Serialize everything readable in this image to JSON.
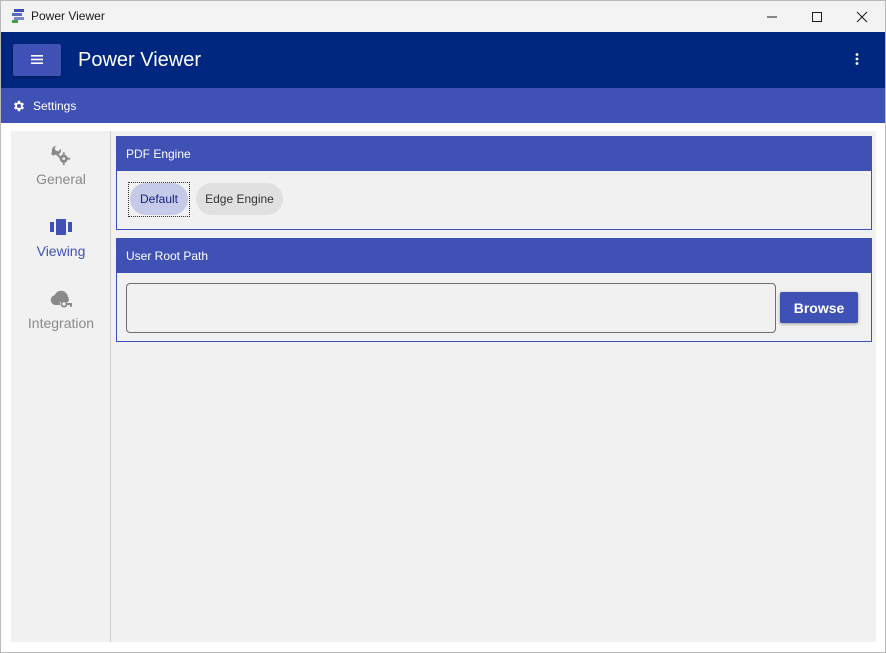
{
  "window": {
    "title": "Power Viewer"
  },
  "appbar": {
    "title": "Power Viewer",
    "menu_icon": "hamburger-icon",
    "more_icon": "kebab-icon"
  },
  "breadcrumb": {
    "icon": "gear-icon",
    "label": "Settings"
  },
  "nav": {
    "items": [
      {
        "label": "General",
        "icon": "wrench-gear-icon",
        "active": false
      },
      {
        "label": "Viewing",
        "icon": "viewing-icon",
        "active": true
      },
      {
        "label": "Integration",
        "icon": "cloud-key-icon",
        "active": false
      }
    ]
  },
  "pdf_engine": {
    "title": "PDF Engine",
    "options": [
      {
        "label": "Default",
        "selected": true
      },
      {
        "label": "Edge Engine",
        "selected": false
      }
    ]
  },
  "user_root_path": {
    "title": "User Root Path",
    "value": "",
    "browse_label": "Browse"
  },
  "colors": {
    "appbar": "#002780",
    "accent": "#3f51b5",
    "chip_selected": "#c5cae9",
    "chip_normal": "#e0e0e0",
    "background": "#f1f1f1"
  }
}
